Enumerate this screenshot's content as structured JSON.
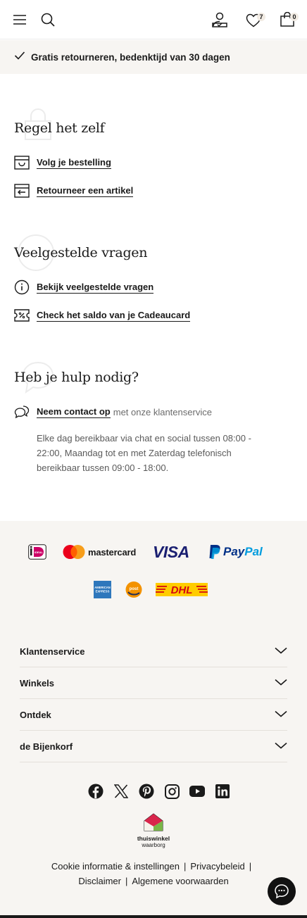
{
  "header": {
    "cart_count": "7",
    "bag_count": "0",
    "icons": [
      "menu-icon",
      "search-icon",
      "account-icon",
      "heart-icon",
      "bag-icon"
    ]
  },
  "usp": {
    "text": "Gratis retourneren, bedenktijd van 30 dagen"
  },
  "self_service": {
    "title": "Regel het zelf",
    "links": [
      {
        "label": "Volg je bestelling",
        "icon": "box-icon"
      },
      {
        "label": "Retourneer een artikel",
        "icon": "return-icon"
      }
    ]
  },
  "faq": {
    "title": "Veelgestelde vragen",
    "links": [
      {
        "label": "Bekijk veelgestelde vragen",
        "icon": "info-icon"
      },
      {
        "label": "Check het saldo van je Cadeaucard",
        "icon": "giftcard-icon"
      }
    ]
  },
  "help": {
    "title": "Heb je hulp nodig?",
    "contact_label": "Neem contact op",
    "contact_suffix": "met onze klantenservice",
    "hours": "Elke dag bereikbaar via chat en social tussen 08:00 - 22:00, Maandag tot en met Zaterdag telefonisch bereikbaar tussen 09:00 - 18:00."
  },
  "payments": {
    "ideal": "iDEAL",
    "mastercard": "mastercard",
    "visa": "VISA",
    "paypal_pay": "Pay",
    "paypal_pal": "Pal",
    "amex": "AMERICAN EXPRESS",
    "postnl": "post nl",
    "dhl": "DHL"
  },
  "footer_accordion": [
    {
      "label": "Klantenservice"
    },
    {
      "label": "Winkels"
    },
    {
      "label": "Ontdek"
    },
    {
      "label": "de Bijenkorf"
    }
  ],
  "social": [
    "facebook-icon",
    "x-icon",
    "pinterest-icon",
    "instagram-icon",
    "youtube-icon",
    "linkedin-icon"
  ],
  "thuiswinkel": {
    "name": "thuiswinkel",
    "sub": "waarborg"
  },
  "legal": {
    "cookie": "Cookie informatie & instellingen",
    "privacy": "Privacybeleid",
    "disclaimer": "Disclaimer",
    "terms": "Algemene voorwaarden",
    "separator": "|"
  },
  "colors": {
    "text": "#1a1a1a",
    "footer_bg": "#f7f5f2",
    "mastercard_red": "#eb001b",
    "mastercard_orange": "#f79e1b",
    "visa_blue": "#1a1f71",
    "paypal_dark": "#003087",
    "paypal_light": "#009cde",
    "dhl_yellow": "#ffcc00",
    "dhl_red": "#d40511",
    "amex_blue": "#2e77bc",
    "postnl_orange": "#f39200"
  }
}
